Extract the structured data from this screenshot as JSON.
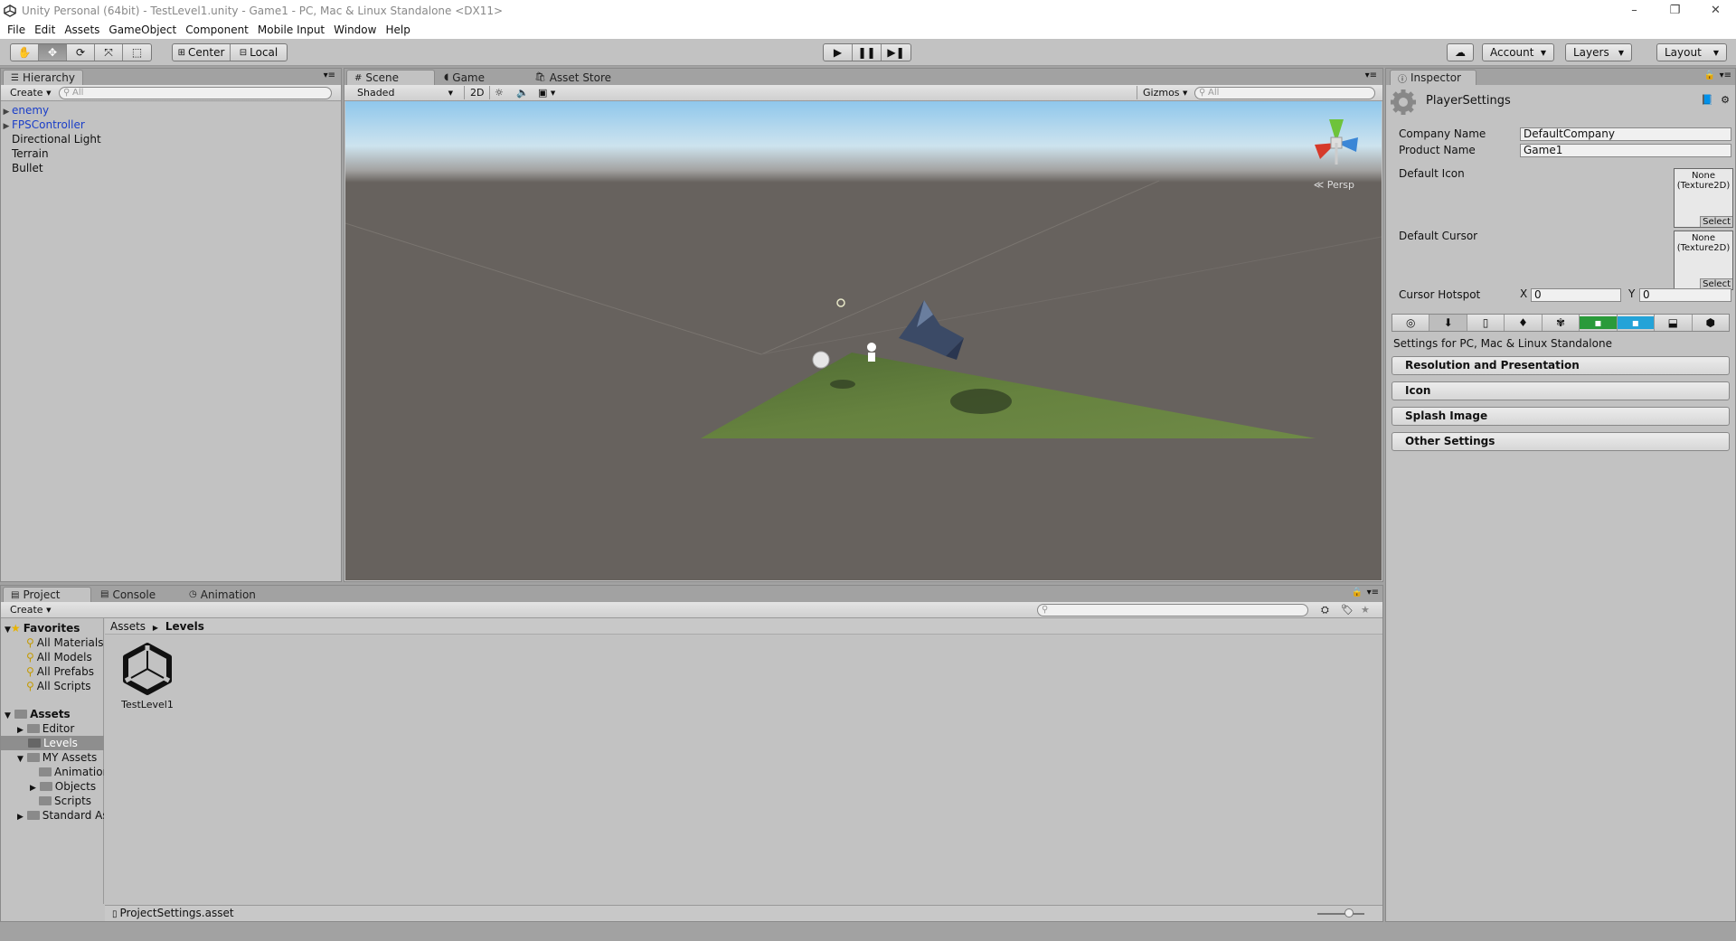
{
  "titlebar": {
    "title": "Unity Personal (64bit) - TestLevel1.unity - Game1 - PC, Mac & Linux Standalone <DX11>",
    "minimize": "–",
    "maximize": "❐",
    "close": "✕"
  },
  "menu": [
    "File",
    "Edit",
    "Assets",
    "GameObject",
    "Component",
    "Mobile Input",
    "Window",
    "Help"
  ],
  "toolbar": {
    "pivot": "Center",
    "space": "Local",
    "account": "Account",
    "layers": "Layers",
    "layout": "Layout"
  },
  "hierarchy": {
    "tab": "Hierarchy",
    "create": "Create",
    "search_placeholder": "All",
    "items": [
      {
        "label": "enemy",
        "prefab": true,
        "expandable": true
      },
      {
        "label": "FPSController",
        "prefab": true,
        "expandable": true
      },
      {
        "label": "Directional Light",
        "prefab": false,
        "expandable": false
      },
      {
        "label": "Terrain",
        "prefab": false,
        "expandable": false
      },
      {
        "label": "Bullet",
        "prefab": false,
        "expandable": false
      }
    ]
  },
  "scene": {
    "tabs": [
      "Scene",
      "Game",
      "Asset Store"
    ],
    "shading": "Shaded",
    "mode_2d": "2D",
    "gizmos": "Gizmos",
    "search_placeholder": "All",
    "persp_label": "Persp"
  },
  "inspector": {
    "tab": "Inspector",
    "object_name": "PlayerSettings",
    "company_label": "Company Name",
    "company_value": "DefaultCompany",
    "product_label": "Product Name",
    "product_value": "Game1",
    "default_icon_label": "Default Icon",
    "default_cursor_label": "Default Cursor",
    "texture_none": "None",
    "texture_type": "(Texture2D)",
    "select": "Select",
    "hotspot_label": "Cursor Hotspot",
    "hotspot_x_label": "X",
    "hotspot_x": "0",
    "hotspot_y_label": "Y",
    "hotspot_y": "0",
    "settings_for": "Settings for PC, Mac & Linux Standalone",
    "sections": [
      "Resolution and Presentation",
      "Icon",
      "Splash Image",
      "Other Settings"
    ]
  },
  "project": {
    "tabs": [
      "Project",
      "Console",
      "Animation"
    ],
    "create": "Create",
    "favorites_label": "Favorites",
    "favorites": [
      "All Materials",
      "All Models",
      "All Prefabs",
      "All Scripts"
    ],
    "assets_label": "Assets",
    "tree": [
      {
        "label": "Editor",
        "expandable": true,
        "depth": 1
      },
      {
        "label": "Levels",
        "expandable": false,
        "depth": 1,
        "selected": true
      },
      {
        "label": "MY Assets",
        "expandable": true,
        "expanded": true,
        "depth": 1
      },
      {
        "label": "Animation",
        "expandable": false,
        "depth": 2
      },
      {
        "label": "Objects",
        "expandable": true,
        "depth": 2
      },
      {
        "label": "Scripts",
        "expandable": false,
        "depth": 2
      },
      {
        "label": "Standard Assets",
        "expandable": true,
        "depth": 1
      }
    ],
    "breadcrumb_root": "Assets",
    "breadcrumb_current": "Levels",
    "asset_name": "TestLevel1",
    "status_file": "ProjectSettings.asset"
  },
  "colors": {
    "prefab_text": "#1a3ec8",
    "panel_bg": "#c2c2c2",
    "scene_ground": "#67625e",
    "terrain": "#56713a"
  },
  "icons": [
    "hand-tool-icon",
    "move-tool-icon",
    "rotate-tool-icon",
    "scale-tool-icon",
    "rect-tool-icon",
    "play-icon",
    "pause-icon",
    "step-icon",
    "cloud-icon",
    "unity-logo-icon",
    "gear-icon"
  ]
}
